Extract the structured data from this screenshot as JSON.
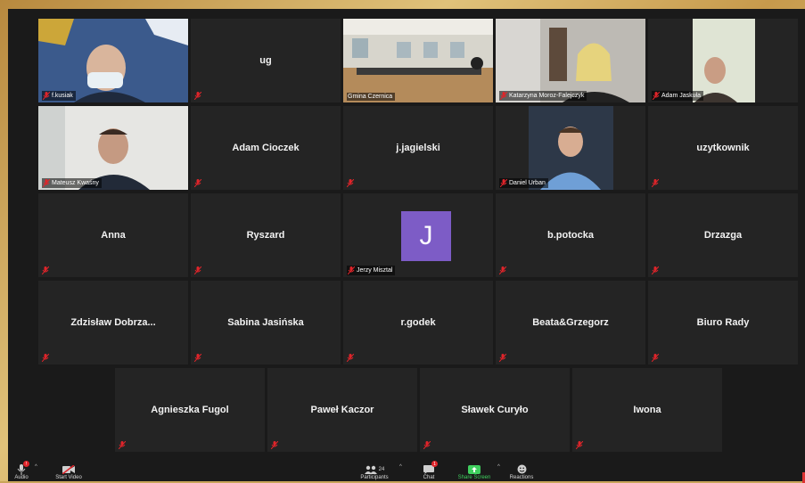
{
  "participants_grid": {
    "row1": [
      {
        "name": "f.kusiak",
        "video": true
      },
      {
        "name": "ug",
        "video": false
      },
      {
        "name": "Gmina Czernica",
        "video": true,
        "active_speaker": true
      },
      {
        "name": "Katarzyna Moroz-Falejczyk",
        "video": true
      },
      {
        "name": "Adam Jaskuła",
        "video": true
      }
    ],
    "row2": [
      {
        "name": "Mateusz Kwaśny",
        "video": true
      },
      {
        "name": "Adam Cioczek",
        "video": false
      },
      {
        "name": "j.jagielski",
        "video": false
      },
      {
        "name": "Daniel Urban",
        "video": true
      },
      {
        "name": "uzytkownik",
        "video": false
      }
    ],
    "row3": [
      {
        "name": "Anna",
        "video": false
      },
      {
        "name": "Ryszard",
        "video": false
      },
      {
        "name": "Jerzy Misztal",
        "video": false,
        "avatar_letter": "J"
      },
      {
        "name": "b.potocka",
        "video": false
      },
      {
        "name": "Drzazga",
        "video": false
      }
    ],
    "row4": [
      {
        "name": "Zdzisław  Dobrza...",
        "video": false
      },
      {
        "name": "Sabina Jasińska",
        "video": false
      },
      {
        "name": "r.godek",
        "video": false
      },
      {
        "name": "Beata&Grzegorz",
        "video": false
      },
      {
        "name": "Biuro Rady",
        "video": false
      }
    ],
    "row5": [
      {
        "name": "Agnieszka Fugol",
        "video": false
      },
      {
        "name": "Paweł Kaczor",
        "video": false
      },
      {
        "name": "Sławek Curyło",
        "video": false
      },
      {
        "name": "Iwona",
        "video": false
      }
    ]
  },
  "toolbar": {
    "audio_label": "Audio",
    "start_video_label": "Start Video",
    "participants_label": "Participants",
    "participants_count": "24",
    "chat_label": "Chat",
    "chat_badge": "1",
    "share_screen_label": "Share Screen",
    "reactions_label": "Reactions",
    "audio_badge": "!"
  },
  "colors": {
    "tile_bg": "#242424",
    "active_border": "#c8d64a",
    "muted_icon": "#e0242a",
    "avatar_bg": "#7d5cc6",
    "share_green": "#3fcf5e"
  }
}
